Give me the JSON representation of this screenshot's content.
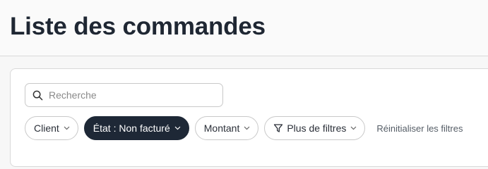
{
  "header": {
    "title": "Liste des commandes"
  },
  "search": {
    "placeholder": "Recherche",
    "value": "",
    "icon": "search-icon"
  },
  "filters": {
    "client_label": "Client",
    "state_label": "État : Non facturé",
    "amount_label": "Montant",
    "more_label": "Plus de filtres",
    "reset_label": "Réinitialiser les filtres",
    "active_color": "#1e2836"
  }
}
